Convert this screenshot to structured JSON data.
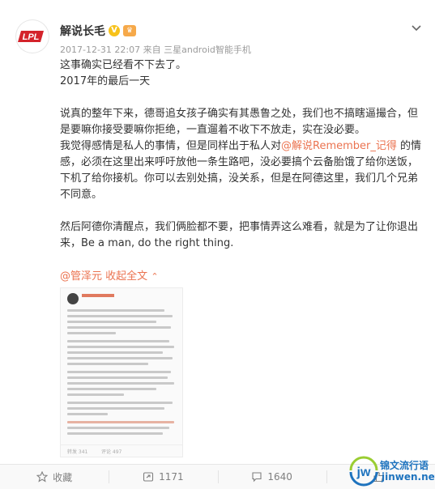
{
  "post": {
    "username": "解说长毛",
    "avatar_text": "LPL",
    "meta": "2017-12-31 22:07 来自 三星android智能手机",
    "lines": {
      "l1": "这事确实已经看不下去了。",
      "l2": "2017年的最后一天",
      "p1": "说真的整年下来，德哥追女孩子确实有其愚鲁之处，我们也不搞瞎逼撮合，但是要嘛你接受要嘛你拒绝，一直遛着不收下不放走，实在没必要。",
      "p2_a": "我觉得感情是私人的事情，但是同样出于私人对",
      "p2_mention": "@解说Remember_记得",
      "p2_b": " 的情感，必须在这里出来呼吁放他一条生路吧，没必要搞个云备胎饿了给你送饭，下机了给你接机。你可以去别处搞，没关系，但是在阿德这里，我们几个兄弟不同意。",
      "p3": "然后阿德你清醒点，我们俩脸都不要，把事情弄这么难看，就是为了让你退出来，Be a man, do the right thing."
    },
    "forward_mention": "@管泽元",
    "expand_label": "收起全文",
    "thumbnail_footer": {
      "forward_count": "转发 341",
      "comment_count": "评论 497"
    }
  },
  "actions": [
    {
      "icon": "star-icon",
      "label": "收藏"
    },
    {
      "icon": "forward-icon",
      "label": "1171"
    },
    {
      "icon": "comment-icon",
      "label": "1640"
    },
    {
      "icon": "like-icon",
      "label": ""
    }
  ],
  "watermark": {
    "logo_text": "jw",
    "name": "锦文流行语",
    "domain": "jinwen.net"
  },
  "colors": {
    "link": "#eb7350",
    "lpl_red": "#d4232b",
    "watermark_blue": "#1e73be"
  }
}
